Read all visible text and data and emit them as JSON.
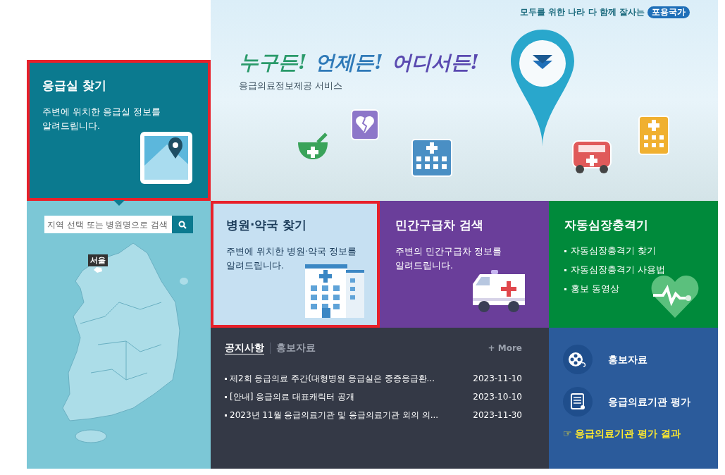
{
  "tagline": {
    "text": "모두를 위한 나라 다 함께 잘사는",
    "badge": "포용국가"
  },
  "hero": {
    "slogan": [
      "누구든!",
      "언제든!",
      "어디서든!"
    ],
    "subtitle": "응급의료정보제공 서비스"
  },
  "emergency_tile": {
    "title": "응급실 찾기",
    "description_lines": [
      "주변에 위치한 응급실 정보를",
      "알려드립니다."
    ],
    "highlighted": true
  },
  "map": {
    "search_placeholder": "지역 선택 또는 병원명으로 검색",
    "selected_region": "서울"
  },
  "tiles": [
    {
      "kind": "hospital",
      "title": "병원·약국 찾기",
      "description_lines": [
        "주변에 위치한 병원·약국 정보를",
        "알려드립니다."
      ],
      "highlighted": true
    },
    {
      "kind": "ambulance",
      "title": "민간구급차 검색",
      "description_lines": [
        "주변의 민간구급차 정보를",
        "알려드립니다."
      ],
      "highlighted": false
    },
    {
      "kind": "aed",
      "title": "자동심장충격기",
      "links": [
        "자동심장충격기 찾기",
        "자동심장충격기 사용법",
        "홍보 동영상"
      ],
      "highlighted": false
    }
  ],
  "notices": {
    "tabs": [
      {
        "label": "공지사항",
        "selected": true
      },
      {
        "label": "홍보자료",
        "selected": false
      }
    ],
    "more": "+ More",
    "items": [
      {
        "title": "제2회 응급의료 주간(대형병원 응급실은 중증응급환...",
        "date": "2023-11-10"
      },
      {
        "title": "[안내] 응급의료 대표캐릭터 공개",
        "date": "2023-10-10"
      },
      {
        "title": "2023년 11월 응급의료기관 및 응급의료기관 외의 의...",
        "date": "2023-11-30"
      }
    ]
  },
  "links": {
    "items": [
      {
        "kind": "film",
        "label": "홍보자료"
      },
      {
        "kind": "document",
        "label": "응급의료기관 평가"
      }
    ],
    "highlight": {
      "icon": "☞",
      "label": "응급의료기관 평가 결과"
    }
  }
}
